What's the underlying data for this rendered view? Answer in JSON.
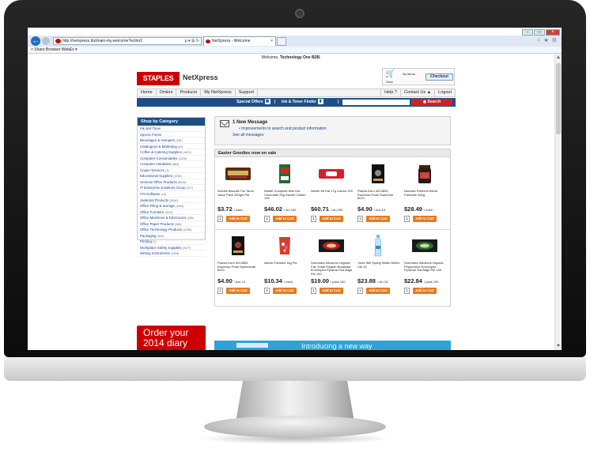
{
  "browser": {
    "url": "http://netxpress.biz/main-my.welcome?ecltnr2",
    "tab_title": "NetXpress - Welcome",
    "tab_close": "×",
    "back": "←",
    "addr_icons": "ρ ▾ ☰ ↻",
    "right_icons": [
      "⌂",
      "★",
      "⚙"
    ],
    "window_buttons": [
      "–",
      "▭",
      "×"
    ],
    "toolbar": "×   Share Browser   WebEx ▾"
  },
  "welcome": {
    "prefix": "Welcome,",
    "name": "Technology One B2B."
  },
  "header": {
    "logo": "STAPLES",
    "brand": "NetXpress"
  },
  "cart": {
    "icon": "🛒",
    "view": "View",
    "no_items": "No items.",
    "checkout": "Checkout"
  },
  "nav": {
    "items": [
      "Home",
      "Orders",
      "Products",
      "My NetXpress",
      "Support"
    ],
    "help": "Help ?",
    "contact": "Contact Us ▲",
    "logout": "Logout"
  },
  "bluebar": {
    "special_offers": "Special Offers",
    "ink_finder": "Ink & Toner Finder",
    "sep": "|",
    "search_btn": "Search"
  },
  "categories": {
    "title": "Shop by Category",
    "items": [
      {
        "label": "Ink and Toner",
        "count": ""
      },
      {
        "label": "Xpress Forms",
        "count": ""
      },
      {
        "label": "Beverages & Hampers",
        "count": "(261)"
      },
      {
        "label": "Catalogues & Marketing",
        "count": "(93)"
      },
      {
        "label": "Coffee & Catering Supplies",
        "count": "(1623)"
      },
      {
        "label": "Computer Consumables",
        "count": "(3226)"
      },
      {
        "label": "Computer Hardware",
        "count": "(884)"
      },
      {
        "label": "Copier Services",
        "count": "(1)"
      },
      {
        "label": "Educational Supplies",
        "count": "(2236)"
      },
      {
        "label": "General Office Products",
        "count": "(5025)"
      },
      {
        "label": "IT Enterprise Solutions Group",
        "count": "(117)"
      },
      {
        "label": "ITS-Software",
        "count": "(10)"
      },
      {
        "label": "Janitorial Products",
        "count": "(2634)"
      },
      {
        "label": "Office Filing & Storage",
        "count": "(1634)"
      },
      {
        "label": "Office Furniture",
        "count": "(3115)"
      },
      {
        "label": "Office Machines & Electronics",
        "count": "(438)"
      },
      {
        "label": "Office Paper Products",
        "count": "(388)"
      },
      {
        "label": "Office Technology Products",
        "count": "(1036)"
      },
      {
        "label": "Packaging",
        "count": "(302)"
      },
      {
        "label": "Printing",
        "count": "(1)"
      },
      {
        "label": "Workplace Safety Supplies",
        "count": "(3977)"
      },
      {
        "label": "Writing Instruments",
        "count": "(1939)"
      }
    ]
  },
  "promo": {
    "line1": "Order your",
    "line2": "2014 diary"
  },
  "message": {
    "title": "1 New Message",
    "line": "•  Improvements to search and product information",
    "all": "See all messages"
  },
  "easter": {
    "title": "Easter Goodies now on sale",
    "add_label": "Add to Cart",
    "qty": "1",
    "row1": [
      {
        "name": "Arnotts Biscuits Tim Tams Value Pack 330gm Pkt",
        "price": "$3.72",
        "unit": "/ each",
        "img": "timtam"
      },
      {
        "name": "Nestle Complete Milo Hot Chocolate 25g Sachet Carton 100",
        "price": "$46.02",
        "unit": "/ ctn 100",
        "img": "milo"
      },
      {
        "name": "Nestle Kit Kat 17g Carton 200",
        "price": "$60.71",
        "unit": "/ ctn 200",
        "img": "kitkat"
      },
      {
        "name": "Piazza Doro 4013803 Espresso Pods Superiore 8x10",
        "price": "$4.90",
        "unit": "/ box 10",
        "img": "pods"
      },
      {
        "name": "Nescafe Partners Blend Fairtrade 450g",
        "price": "$28.49",
        "unit": "/ each",
        "img": "jar"
      }
    ],
    "row2": [
      {
        "name": "Piazza Doro 4013805 Espresso Pods Splendente 8x10",
        "price": "$4.90",
        "unit": "/ box 10",
        "img": "pods2"
      },
      {
        "name": "Allens Freckles 1kg Pkt",
        "price": "$10.34",
        "unit": "/ each",
        "img": "freckles"
      },
      {
        "name": "Sorrentea Infusions Organic Fair Trade English Breakfast Enveloped Pyramid Tea Bags Pkt 100",
        "price": "$19.00",
        "unit": "/ pack 100",
        "img": "tea"
      },
      {
        "name": "Yarra Still Spring Water 500ml Ctn 24",
        "price": "$23.88",
        "unit": "/ ctn 24",
        "img": "water"
      },
      {
        "name": "Sorrentea Infusions Organic Peppermint Enveloped Pyramid Tea Bags Pkt 100",
        "price": "$22.84",
        "unit": "/ pack 100",
        "img": "tea2"
      }
    ]
  },
  "banner": {
    "text": "Introducing a new way"
  }
}
